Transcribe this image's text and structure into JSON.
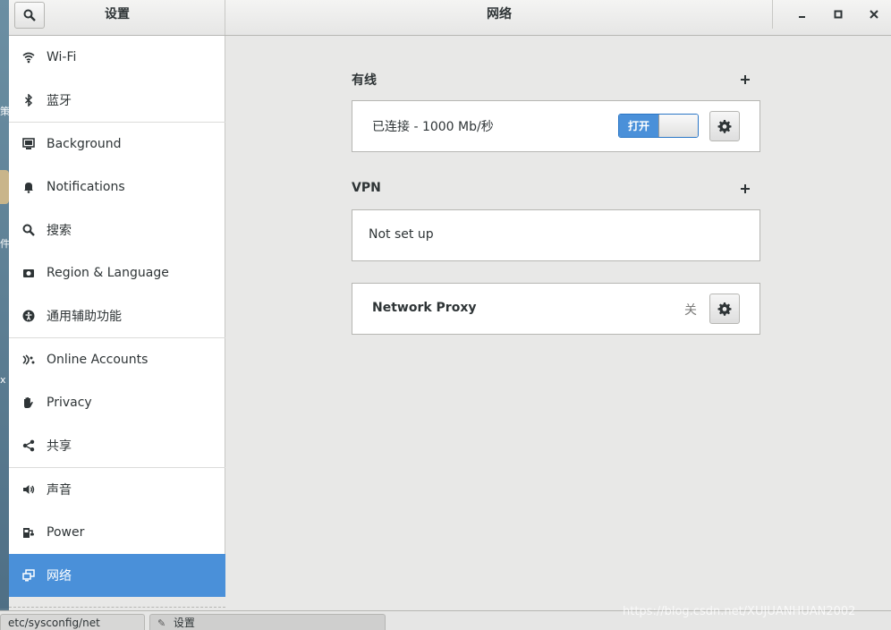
{
  "desktop": {
    "glyphs": [
      "策",
      "件",
      "x"
    ]
  },
  "header": {
    "sidebar_title": "设置",
    "title": "网络"
  },
  "sidebar": {
    "items": [
      {
        "label": "Wi-Fi",
        "icon": "wifi-icon"
      },
      {
        "label": "蓝牙",
        "icon": "bluetooth-icon"
      },
      {
        "label": "Background",
        "icon": "background-icon"
      },
      {
        "label": "Notifications",
        "icon": "bell-icon"
      },
      {
        "label": "搜索",
        "icon": "search-icon"
      },
      {
        "label": "Region & Language",
        "icon": "region-icon"
      },
      {
        "label": "通用辅助功能",
        "icon": "accessibility-icon"
      },
      {
        "label": "Online Accounts",
        "icon": "online-accounts-icon"
      },
      {
        "label": "Privacy",
        "icon": "hand-icon"
      },
      {
        "label": "共享",
        "icon": "share-icon"
      },
      {
        "label": "声音",
        "icon": "speaker-icon"
      },
      {
        "label": "Power",
        "icon": "power-icon"
      },
      {
        "label": "网络",
        "icon": "network-icon",
        "active": true
      }
    ]
  },
  "wired": {
    "title": "有线",
    "status": "已连接 - 1000 Mb/秒",
    "switch_label": "打开"
  },
  "vpn": {
    "title": "VPN",
    "status": "Not set up"
  },
  "proxy": {
    "label": "Network Proxy",
    "state": "关"
  },
  "taskbar": {
    "task1": "etc/sysconfig/net",
    "task2": "设置"
  },
  "watermark": "https://blog.csdn.net/XUJUANHUAN2002",
  "colors": {
    "accent": "#4a90d9",
    "window_bg": "#e8e8e7",
    "sidebar_bg": "#ffffff",
    "desktop": "#5d7a8c"
  }
}
